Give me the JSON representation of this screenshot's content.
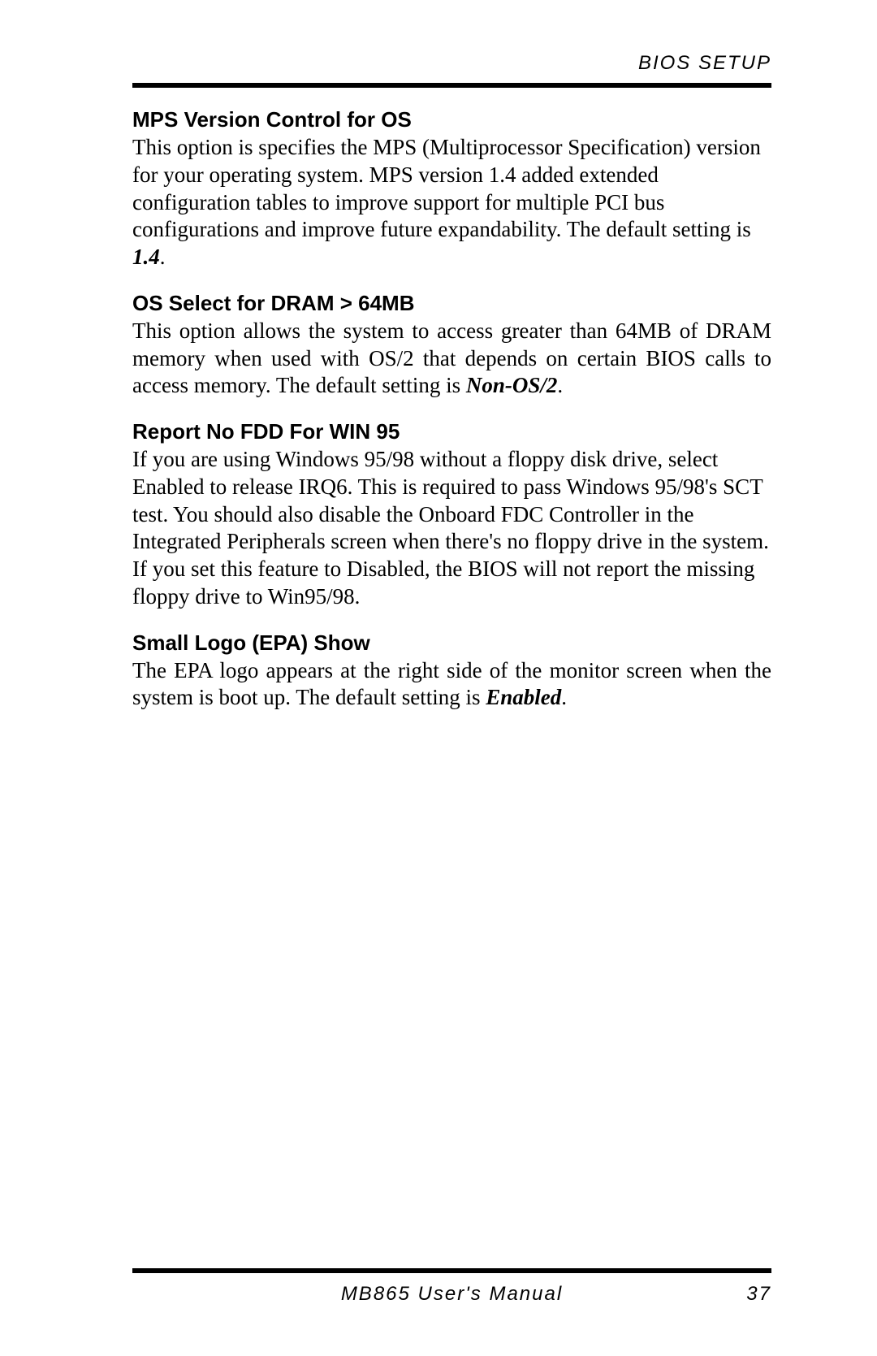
{
  "header": {
    "label": "BIOS SETUP"
  },
  "sections": [
    {
      "heading": "MPS Version Control for OS",
      "body_pre": "This option is specifies the MPS (Multiprocessor Specification) version for your operating system. MPS version 1.4 added extended configuration tables to improve support for multiple PCI bus configurations and improve future expandability. The default setting is ",
      "body_emph": "1.4",
      "body_post": ".",
      "justify": false
    },
    {
      "heading": "OS Select for DRAM > 64MB",
      "body_pre": "This option allows the system to access greater than 64MB of DRAM memory when used with OS/2 that depends on certain BIOS calls to access memory. The default setting is ",
      "body_emph": "Non-OS/2",
      "body_post": ".",
      "justify": true
    },
    {
      "heading": "Report No FDD For WIN 95",
      "body_pre": "If you are using Windows 95/98 without a floppy disk drive, select Enabled to release IRQ6. This is required to pass Windows 95/98's SCT test. You should also disable the Onboard FDC Controller in the Integrated Peripherals screen when there's no floppy drive in the system. If you set this feature to Disabled, the BIOS will not report the missing floppy drive to Win95/98.",
      "body_emph": "",
      "body_post": "",
      "justify": false
    },
    {
      "heading": "Small Logo (EPA) Show",
      "body_pre": "The EPA logo appears at the right side of the monitor screen when the system is boot up. The default setting is ",
      "body_emph": "Enabled",
      "body_post": ".",
      "justify": true
    }
  ],
  "footer": {
    "title": "MB865 User's Manual",
    "page": "37"
  }
}
